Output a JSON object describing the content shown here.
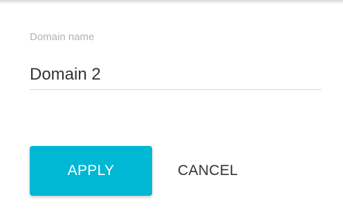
{
  "dialog": {
    "field": {
      "label": "Domain name",
      "value": "Domain 2"
    },
    "actions": {
      "apply_label": "APPLY",
      "cancel_label": "CANCEL"
    }
  },
  "colors": {
    "accent": "#00b8d4",
    "label": "#b3b3b3",
    "text": "#333333",
    "underline": "#d9d9d9"
  }
}
